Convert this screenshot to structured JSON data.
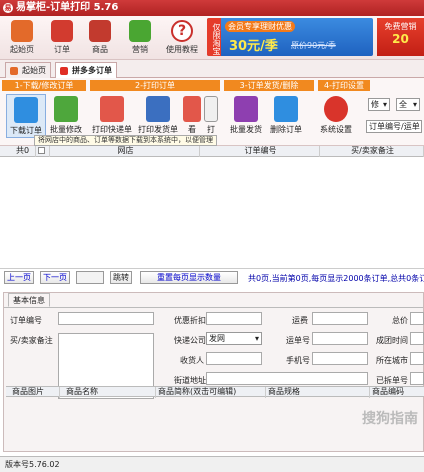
{
  "window": {
    "title": "易掌柜-订单打印 5.76",
    "logo_char": "易"
  },
  "toolbar": {
    "items": [
      {
        "label": "起始页",
        "icon": "house-icon",
        "color": "#e36a2a"
      },
      {
        "label": "订单",
        "icon": "cart-icon",
        "color": "#d23b2f"
      },
      {
        "label": "商品",
        "icon": "store-icon",
        "color": "#c23a2e"
      },
      {
        "label": "营销",
        "icon": "chat-icon",
        "color": "#4aa632"
      },
      {
        "label": "使用教程",
        "icon": "help-icon",
        "color": "#c9302c"
      }
    ],
    "banner_vertical": "仅限淘宝",
    "banner_tag": "会员专享理财优惠",
    "banner_price": "30元/季",
    "banner_old_price": "原价90元/季",
    "banner2_line1": "免费营销",
    "banner2_line2": "20"
  },
  "tabs": [
    {
      "label": "起始页",
      "icon": "home-tab-icon"
    },
    {
      "label": "拼多多订单",
      "icon": "pdd-tab-icon"
    }
  ],
  "groups": [
    "1-下载/修改订单",
    "2-打印订单",
    "3-订单发货/删除",
    "4-打印设置"
  ],
  "func_buttons": [
    {
      "label": "下载订单",
      "icon": "download-icon",
      "color": "#2f8ee0"
    },
    {
      "label": "批量修改",
      "icon": "edit-icon",
      "color": "#4ea73c"
    },
    {
      "label": "打印快递单",
      "icon": "printer-icon",
      "color": "#e2574a"
    },
    {
      "label": "打印发货单",
      "icon": "invoice-icon",
      "color": "#3b6fc0"
    },
    {
      "label": "看",
      "icon": "preview-icon",
      "color": "#e2574a"
    },
    {
      "label": "打",
      "icon": "print-small-icon",
      "color": "#999"
    },
    {
      "label": "批量发货",
      "icon": "barcode-icon",
      "color": "#8e3fb0"
    },
    {
      "label": "删除订单",
      "icon": "trash-icon",
      "color": "#2f8ee0"
    },
    {
      "label": "系统设置",
      "icon": "settings-icon",
      "color": "#d9342b"
    }
  ],
  "filter": {
    "select1": "修",
    "select2": "全",
    "search_label": "订单编号/运单"
  },
  "tooltip": "将网店中的商品、订单等数据下载到本系统中，以便管理",
  "grid": {
    "columns": [
      "共0",
      "",
      "网店",
      "订单编号",
      "买/卖家备注"
    ]
  },
  "pager": {
    "prev": "上一页",
    "next": "下一页",
    "jump": "跳转",
    "show_count": "重置每页显示数量",
    "info": "共0页,当前第0页,每页显示2000条订单,总共0条订单"
  },
  "detail": {
    "tab": "基本信息",
    "order_no_label": "订单编号",
    "buyer_note_label": "买/卖家备注",
    "discount_label": "优惠折扣",
    "freight_label": "运费",
    "total_label": "总价",
    "express_label": "快递公司",
    "express_value": "发网",
    "waybill_label": "运单号",
    "deal_time_label": "成团时间",
    "receiver_label": "收货人",
    "phone_label": "手机号",
    "city_label": "所在城市",
    "address_label": "街道地址",
    "split_label": "已拆单号"
  },
  "products": {
    "columns": [
      "商品图片",
      "商品名称",
      "商品简称(双击可编辑)",
      "商品规格",
      "商品编码"
    ]
  },
  "status": {
    "version": "版本号5.76.02"
  },
  "watermark": "搜狗指南"
}
